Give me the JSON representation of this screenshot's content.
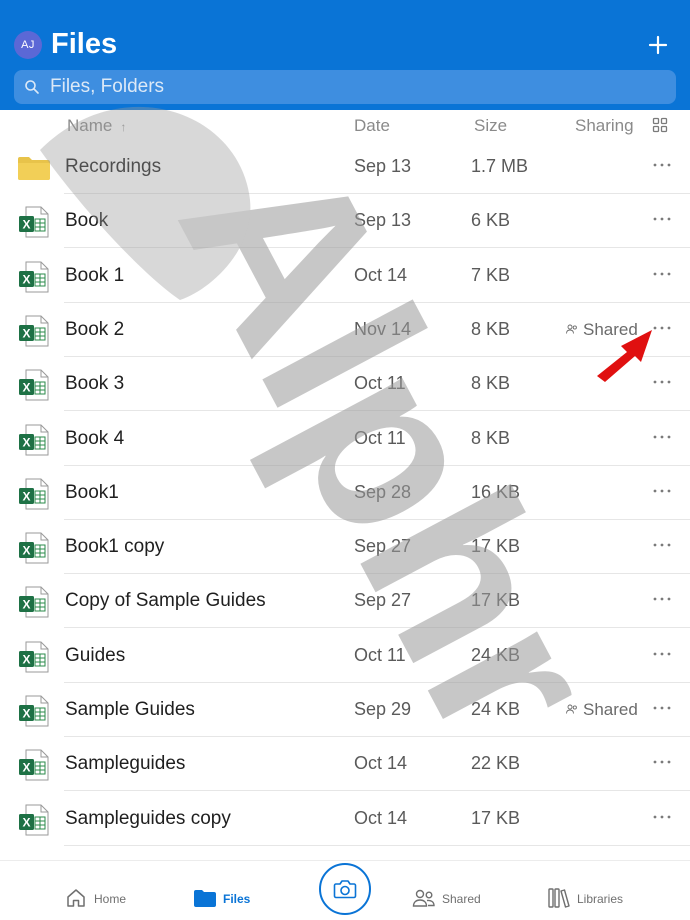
{
  "header": {
    "avatar_initials": "AJ",
    "title": "Files",
    "add_icon": "plus-icon",
    "search": {
      "placeholder": "Files, Folders",
      "icon": "search-icon"
    },
    "color": "#0a74d6"
  },
  "columns": {
    "name": "Name",
    "sort_indicator": "↑",
    "date": "Date",
    "size": "Size",
    "sharing": "Sharing",
    "view_icon": "grid-view-icon"
  },
  "files": [
    {
      "name": "Recordings",
      "date": "Sep 13",
      "size": "1.7 MB",
      "sharing": "",
      "type": "folder"
    },
    {
      "name": "Book",
      "date": "Sep 13",
      "size": "6 KB",
      "sharing": "",
      "type": "excel"
    },
    {
      "name": "Book 1",
      "date": "Oct 14",
      "size": "7 KB",
      "sharing": "",
      "type": "excel"
    },
    {
      "name": "Book 2",
      "date": "Nov 14",
      "size": "8 KB",
      "sharing": "Shared",
      "type": "excel"
    },
    {
      "name": "Book 3",
      "date": "Oct 11",
      "size": "8 KB",
      "sharing": "",
      "type": "excel"
    },
    {
      "name": "Book 4",
      "date": "Oct 11",
      "size": "8 KB",
      "sharing": "",
      "type": "excel"
    },
    {
      "name": "Book1",
      "date": "Sep 28",
      "size": "16 KB",
      "sharing": "",
      "type": "excel"
    },
    {
      "name": "Book1 copy",
      "date": "Sep 27",
      "size": "17 KB",
      "sharing": "",
      "type": "excel"
    },
    {
      "name": "Copy of Sample Guides",
      "date": "Sep 27",
      "size": "17 KB",
      "sharing": "",
      "type": "excel"
    },
    {
      "name": "Guides",
      "date": "Oct 11",
      "size": "24 KB",
      "sharing": "",
      "type": "excel"
    },
    {
      "name": "Sample Guides",
      "date": "Sep 29",
      "size": "24 KB",
      "sharing": "Shared",
      "type": "excel"
    },
    {
      "name": "Sampleguides",
      "date": "Oct 14",
      "size": "22 KB",
      "sharing": "",
      "type": "excel"
    },
    {
      "name": "Sampleguides copy",
      "date": "Oct 14",
      "size": "17 KB",
      "sharing": "",
      "type": "excel"
    }
  ],
  "more_icon": "more-horizontal-icon",
  "tabbar": {
    "home": "Home",
    "files": "Files",
    "shared": "Shared",
    "libraries": "Libraries",
    "camera_icon": "camera-icon",
    "active": "files"
  },
  "annotation": {
    "arrow_color": "#e01010",
    "target": "Book 2 more options"
  },
  "watermark": {
    "text": "Alphr"
  }
}
